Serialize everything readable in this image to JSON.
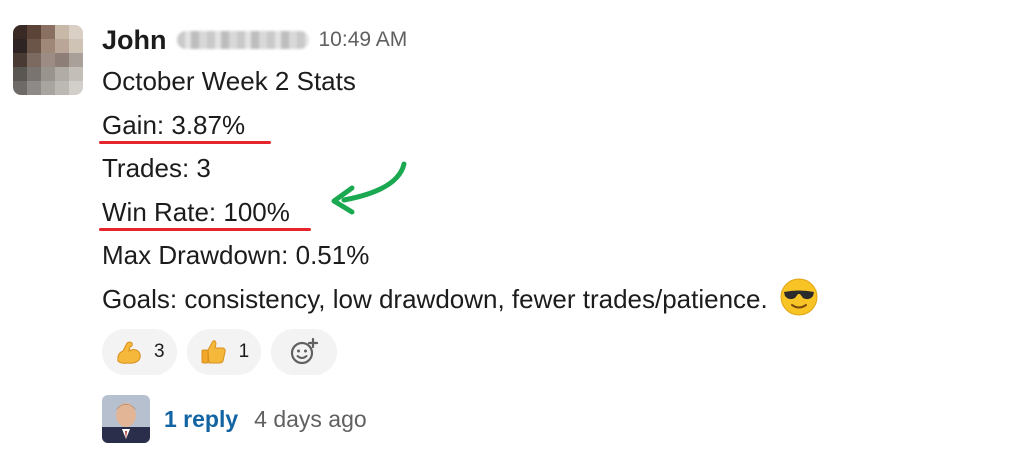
{
  "message": {
    "sender": "John",
    "timestamp": "10:49 AM",
    "lines": {
      "title": "October Week 2 Stats",
      "gain": "Gain: 3.87%",
      "trades": "Trades: 3",
      "win_rate": "Win Rate: 100%",
      "max_drawdown": "Max Drawdown: 0.51%",
      "goals": "Goals: consistency, low drawdown, fewer trades/patience."
    },
    "trailing_emoji": "smiling-face-with-sunglasses-icon"
  },
  "reactions": [
    {
      "emoji": "flexed-biceps-icon",
      "count": "3"
    },
    {
      "emoji": "thumbs-up-icon",
      "count": "1"
    },
    {
      "emoji": "add-reaction-icon"
    }
  ],
  "thread": {
    "reply_label": "1 reply",
    "last_reply": "4 days ago"
  },
  "colors": {
    "annotation_underline": "#e4252b",
    "annotation_arrow": "#1aa851",
    "link": "#1264a3"
  }
}
